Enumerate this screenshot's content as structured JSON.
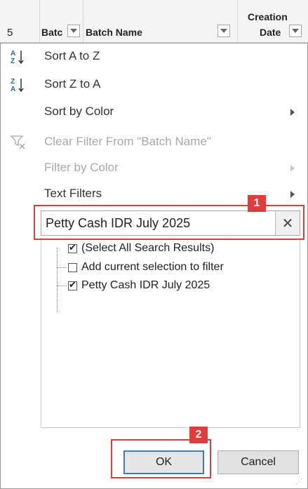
{
  "header": {
    "row_number": "5",
    "col_batch_short": "Batc",
    "col_batch_name": "Batch Name",
    "col_creation_line1": "Creation",
    "col_creation_line2": "Date"
  },
  "menu": {
    "sort_az": "Sort A to Z",
    "sort_za": "Sort Z to A",
    "sort_by_color": "Sort by Color",
    "clear_filter": "Clear Filter From \"Batch Name\"",
    "filter_by_color": "Filter by Color",
    "text_filters": "Text Filters"
  },
  "search": {
    "value": "Petty Cash IDR July 2025",
    "clear_glyph": "✕"
  },
  "list": {
    "items": [
      {
        "label": "(Select All Search Results)",
        "checked": true
      },
      {
        "label": "Add current selection to filter",
        "checked": false
      },
      {
        "label": "Petty Cash IDR July 2025",
        "checked": true
      }
    ]
  },
  "buttons": {
    "ok": "OK",
    "cancel": "Cancel"
  },
  "annotations": {
    "badge1": "1",
    "badge2": "2",
    "highlight_color": "#e23b3b"
  },
  "colors": {
    "ok_border": "#3c7fb1",
    "disabled_text": "#a8a8a8"
  }
}
